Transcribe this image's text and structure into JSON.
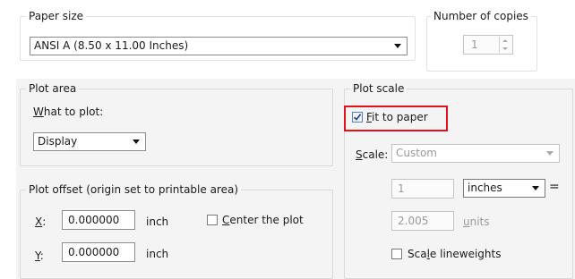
{
  "paper_size": {
    "legend": "Paper size",
    "selected": "ANSI A (8.50 x 11.00 Inches)"
  },
  "copies": {
    "legend": "Number of copies",
    "value": "1"
  },
  "plot_area": {
    "legend": "Plot area",
    "what_label": "What to plot:",
    "what_value": "Display"
  },
  "plot_offset": {
    "legend": "Plot offset (origin set to printable area)",
    "x_label": "X:",
    "x_value": "0.000000",
    "x_unit": "inch",
    "y_label": "Y:",
    "y_value": "0.000000",
    "y_unit": "inch",
    "center_label": "Center the plot",
    "center_checked": false
  },
  "plot_scale": {
    "legend": "Plot scale",
    "fit_label": "Fit to paper",
    "fit_checked": true,
    "scale_label": "Scale:",
    "scale_value": "Custom",
    "numerator": "1",
    "units_select": "inches",
    "equals": "=",
    "denominator": "2.005",
    "units_label": "units",
    "lineweights_label": "Scale lineweights",
    "lineweights_checked": false
  },
  "colors": {
    "highlight": "#e0121b",
    "panel": "#f4f4f4",
    "disabled_text": "#9a9a9a"
  }
}
